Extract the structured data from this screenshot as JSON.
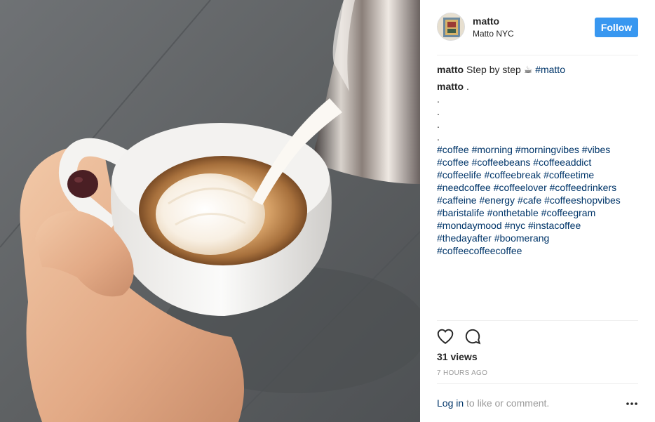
{
  "post": {
    "username": "matto",
    "location": "Matto NYC",
    "follow_label": "Follow",
    "caption": {
      "username": "matto",
      "text_before": "Step by step",
      "emoji": "☕",
      "tag": "#matto"
    },
    "second_comment": {
      "username": "matto",
      "text": ".",
      "dots": [
        ".",
        ".",
        ".",
        "."
      ],
      "hashtag_lines": [
        [
          "#coffee",
          "#morning",
          "#morningvibes",
          "#vibes"
        ],
        [
          "#coffee",
          "#coffeebeans",
          "#coffeeaddict"
        ],
        [
          "#coffeelife",
          "#coffeebreak",
          "#coffeetime"
        ],
        [
          "#needcoffee",
          "#coffeelover",
          "#coffeedrinkers"
        ],
        [
          "#caffeine",
          "#energy",
          "#cafe",
          "#coffeeshopvibes"
        ],
        [
          "#baristalife",
          "#onthetable",
          "#coffeegram"
        ],
        [
          "#mondaymood",
          "#nyc",
          "#instacoffee"
        ],
        [
          "#thedayafter",
          "#boomerang"
        ],
        [
          "#coffeecoffeecoffee"
        ]
      ]
    },
    "views": "31 views",
    "time_ago": "7 HOURS AGO",
    "login_link": "Log in",
    "login_suffix": "to like or comment.",
    "icons": {
      "like": "heart-outline-icon",
      "comment": "speech-bubble-icon",
      "more": "ellipsis-icon"
    }
  },
  "colors": {
    "accent": "#3897f0",
    "link": "#003569",
    "muted": "#999999",
    "text": "#262626"
  }
}
